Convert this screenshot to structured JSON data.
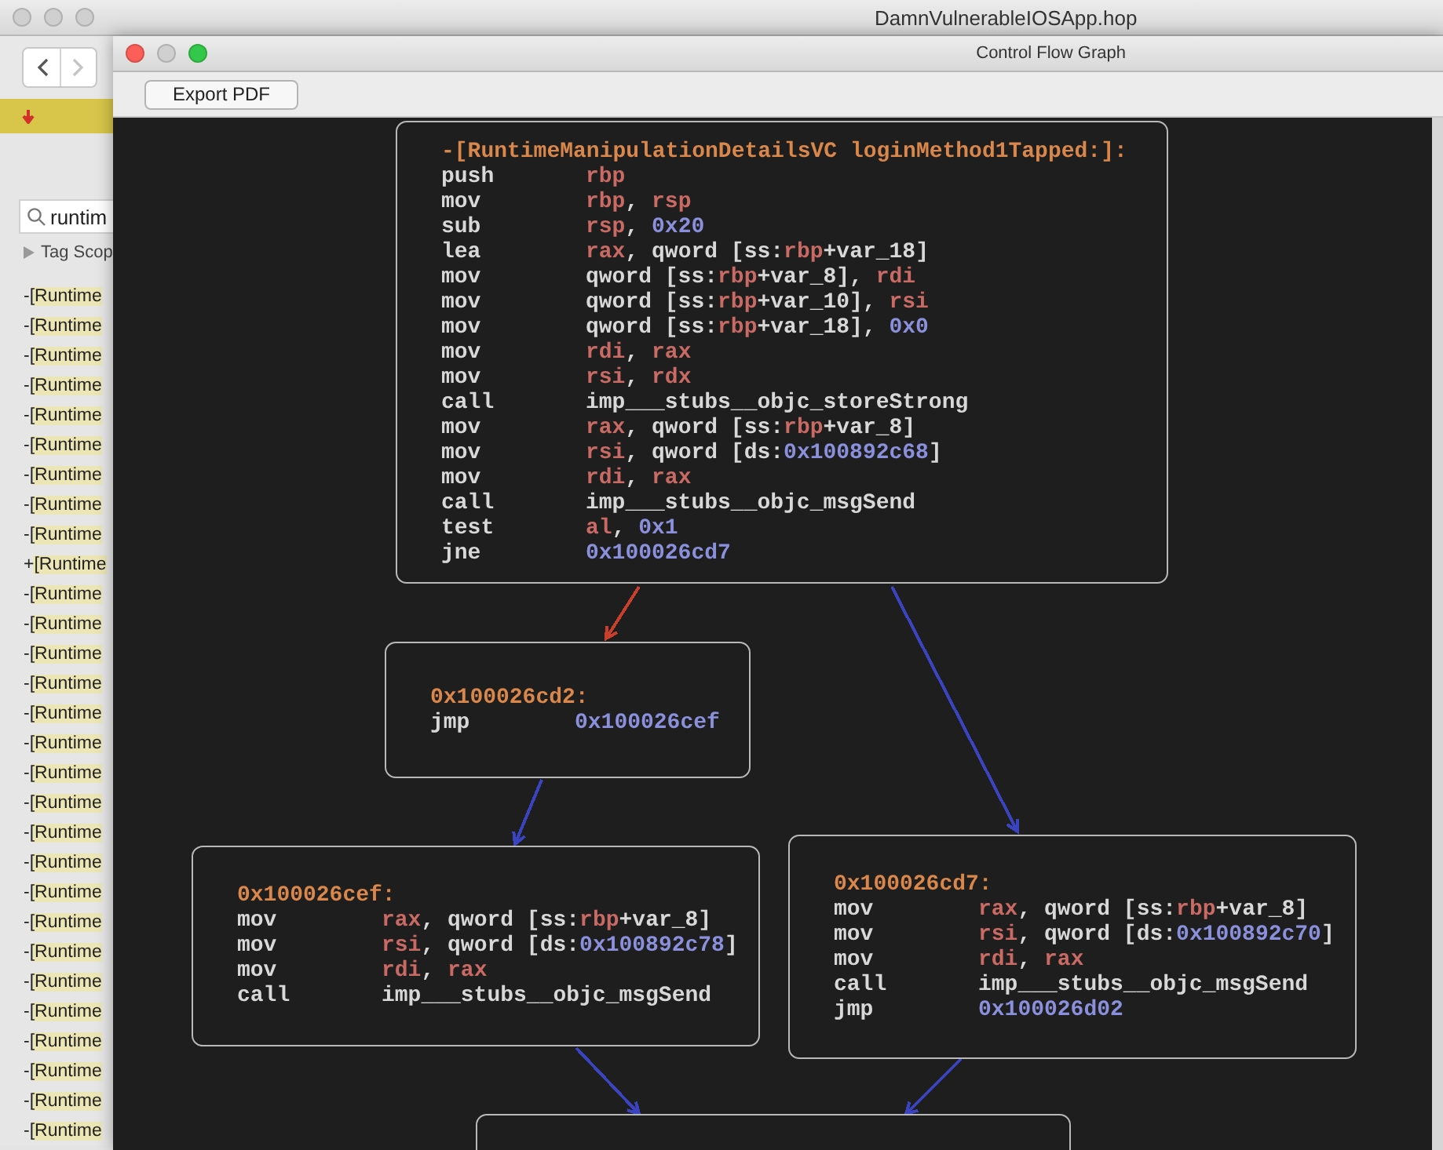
{
  "back_window": {
    "title": "DamnVulnerableIOSApp.hop",
    "search": {
      "value": "runtim"
    },
    "tag_scope": "Tag Scop",
    "items": [
      "-[Runtime",
      "-[Runtime",
      "-[Runtime",
      "-[Runtime",
      "-[Runtime",
      "-[Runtime",
      "-[Runtime",
      "-[Runtime",
      "-[Runtime",
      "+[Runtime",
      "-[Runtime",
      "-[Runtime",
      "-[Runtime",
      "-[Runtime",
      "-[Runtime",
      "-[Runtime",
      "-[Runtime",
      "-[Runtime",
      "-[Runtime",
      "-[Runtime",
      "-[Runtime",
      "-[Runtime",
      "-[Runtime",
      "-[Runtime",
      "-[Runtime",
      "-[Runtime",
      "-[Runtime",
      "-[Runtime",
      "-[Runtime"
    ]
  },
  "window": {
    "title": "Control Flow Graph"
  },
  "toolbar": {
    "buttons": [
      "Export PDF"
    ]
  },
  "graph": {
    "nodes": [
      {
        "label": "-[RuntimeManipulationDetailsVC loginMethod1Tapped:]:",
        "lines": [
          {
            "op": "push",
            "args": [
              {
                "text": "rbp",
                "kind": "reg"
              }
            ]
          },
          {
            "op": "mov",
            "args": [
              {
                "text": "rbp",
                "kind": "reg"
              },
              {
                "text": ", ",
                "kind": "txt"
              },
              {
                "text": "rsp",
                "kind": "reg"
              }
            ]
          },
          {
            "op": "sub",
            "args": [
              {
                "text": "rsp",
                "kind": "reg"
              },
              {
                "text": ", ",
                "kind": "txt"
              },
              {
                "text": "0x20",
                "kind": "num"
              }
            ]
          },
          {
            "op": "lea",
            "args": [
              {
                "text": "rax",
                "kind": "reg"
              },
              {
                "text": ", qword [ss:",
                "kind": "txt"
              },
              {
                "text": "rbp",
                "kind": "reg"
              },
              {
                "text": "+var_18]",
                "kind": "txt"
              }
            ]
          },
          {
            "op": "mov",
            "args": [
              {
                "text": "qword [ss:",
                "kind": "txt"
              },
              {
                "text": "rbp",
                "kind": "reg"
              },
              {
                "text": "+var_8], ",
                "kind": "txt"
              },
              {
                "text": "rdi",
                "kind": "reg"
              }
            ]
          },
          {
            "op": "mov",
            "args": [
              {
                "text": "qword [ss:",
                "kind": "txt"
              },
              {
                "text": "rbp",
                "kind": "reg"
              },
              {
                "text": "+var_10], ",
                "kind": "txt"
              },
              {
                "text": "rsi",
                "kind": "reg"
              }
            ]
          },
          {
            "op": "mov",
            "args": [
              {
                "text": "qword [ss:",
                "kind": "txt"
              },
              {
                "text": "rbp",
                "kind": "reg"
              },
              {
                "text": "+var_18], ",
                "kind": "txt"
              },
              {
                "text": "0x0",
                "kind": "num"
              }
            ]
          },
          {
            "op": "mov",
            "args": [
              {
                "text": "rdi",
                "kind": "reg"
              },
              {
                "text": ", ",
                "kind": "txt"
              },
              {
                "text": "rax",
                "kind": "reg"
              }
            ]
          },
          {
            "op": "mov",
            "args": [
              {
                "text": "rsi",
                "kind": "reg"
              },
              {
                "text": ", ",
                "kind": "txt"
              },
              {
                "text": "rdx",
                "kind": "reg"
              }
            ]
          },
          {
            "op": "call",
            "args": [
              {
                "text": "imp___stubs__objc_storeStrong",
                "kind": "txt"
              }
            ]
          },
          {
            "op": "mov",
            "args": [
              {
                "text": "rax",
                "kind": "reg"
              },
              {
                "text": ", qword [ss:",
                "kind": "txt"
              },
              {
                "text": "rbp",
                "kind": "reg"
              },
              {
                "text": "+var_8]",
                "kind": "txt"
              }
            ]
          },
          {
            "op": "mov",
            "args": [
              {
                "text": "rsi",
                "kind": "reg"
              },
              {
                "text": ", qword [ds:",
                "kind": "txt"
              },
              {
                "text": "0x100892c68",
                "kind": "num"
              },
              {
                "text": "]",
                "kind": "txt"
              }
            ]
          },
          {
            "op": "mov",
            "args": [
              {
                "text": "rdi",
                "kind": "reg"
              },
              {
                "text": ", ",
                "kind": "txt"
              },
              {
                "text": "rax",
                "kind": "reg"
              }
            ]
          },
          {
            "op": "call",
            "args": [
              {
                "text": "imp___stubs__objc_msgSend",
                "kind": "txt"
              }
            ]
          },
          {
            "op": "test",
            "args": [
              {
                "text": "al",
                "kind": "reg"
              },
              {
                "text": ", ",
                "kind": "txt"
              },
              {
                "text": "0x1",
                "kind": "num"
              }
            ]
          },
          {
            "op": "jne",
            "args": [
              {
                "text": "0x100026cd7",
                "kind": "num"
              }
            ]
          }
        ]
      },
      {
        "label": "0x100026cd2:",
        "lines": [
          {
            "op": "jmp",
            "args": [
              {
                "text": "0x100026cef",
                "kind": "num"
              }
            ]
          }
        ]
      },
      {
        "label": "0x100026cef:",
        "lines": [
          {
            "op": "mov",
            "args": [
              {
                "text": "rax",
                "kind": "reg"
              },
              {
                "text": ", qword [ss:",
                "kind": "txt"
              },
              {
                "text": "rbp",
                "kind": "reg"
              },
              {
                "text": "+var_8]",
                "kind": "txt"
              }
            ]
          },
          {
            "op": "mov",
            "args": [
              {
                "text": "rsi",
                "kind": "reg"
              },
              {
                "text": ", qword [ds:",
                "kind": "txt"
              },
              {
                "text": "0x100892c78",
                "kind": "num"
              },
              {
                "text": "]",
                "kind": "txt"
              }
            ]
          },
          {
            "op": "mov",
            "args": [
              {
                "text": "rdi",
                "kind": "reg"
              },
              {
                "text": ", ",
                "kind": "txt"
              },
              {
                "text": "rax",
                "kind": "reg"
              }
            ]
          },
          {
            "op": "call",
            "args": [
              {
                "text": "imp___stubs__objc_msgSend",
                "kind": "txt"
              }
            ]
          }
        ]
      },
      {
        "label": "0x100026cd7:",
        "lines": [
          {
            "op": "mov",
            "args": [
              {
                "text": "rax",
                "kind": "reg"
              },
              {
                "text": ", qword [ss:",
                "kind": "txt"
              },
              {
                "text": "rbp",
                "kind": "reg"
              },
              {
                "text": "+var_8]",
                "kind": "txt"
              }
            ]
          },
          {
            "op": "mov",
            "args": [
              {
                "text": "rsi",
                "kind": "reg"
              },
              {
                "text": ", qword [ds:",
                "kind": "txt"
              },
              {
                "text": "0x100892c70",
                "kind": "num"
              },
              {
                "text": "]",
                "kind": "txt"
              }
            ]
          },
          {
            "op": "mov",
            "args": [
              {
                "text": "rdi",
                "kind": "reg"
              },
              {
                "text": ", ",
                "kind": "txt"
              },
              {
                "text": "rax",
                "kind": "reg"
              }
            ]
          },
          {
            "op": "call",
            "args": [
              {
                "text": "imp___stubs__objc_msgSend",
                "kind": "txt"
              }
            ]
          },
          {
            "op": "jmp",
            "args": [
              {
                "text": "0x100026d02",
                "kind": "num"
              }
            ]
          }
        ]
      }
    ],
    "edges": [
      {
        "color": "#c8402c"
      },
      {
        "color": "#3a43c0"
      },
      {
        "color": "#3a43c0"
      },
      {
        "color": "#3a43c0"
      },
      {
        "color": "#3a43c0"
      }
    ]
  }
}
